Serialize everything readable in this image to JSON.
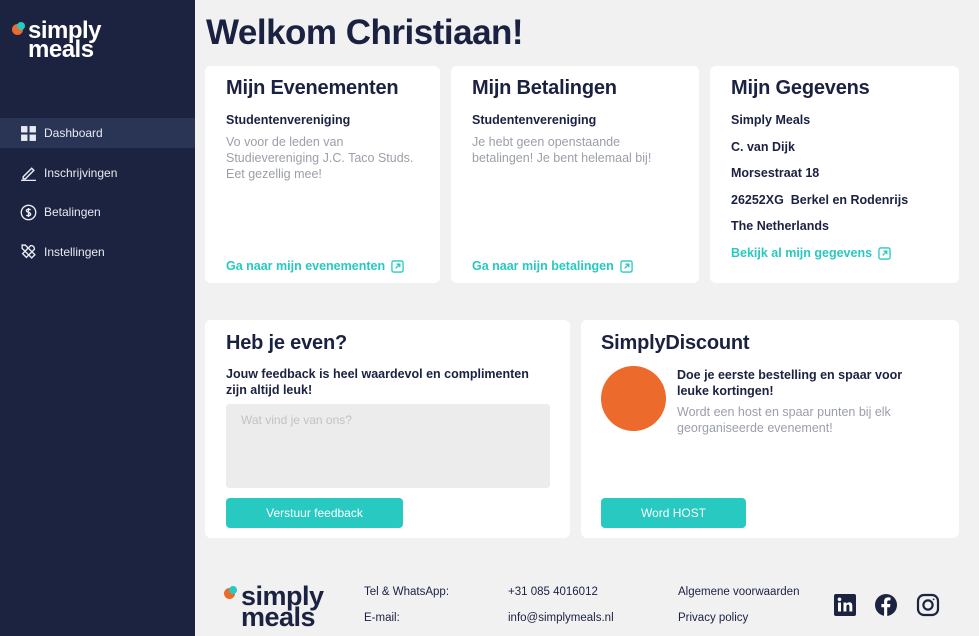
{
  "brand": {
    "logo_line1": "simply",
    "logo_line2": "meals",
    "orange": "#ec6a2b",
    "teal": "#27c9c0",
    "navy": "#1c2340"
  },
  "sidebar": {
    "items": [
      {
        "label": "Dashboard",
        "icon": "grid-icon",
        "active": true
      },
      {
        "label": "Inschrijvingen",
        "icon": "pencil-icon"
      },
      {
        "label": "Betalingen",
        "icon": "dollar-circle-icon"
      },
      {
        "label": "Instellingen",
        "icon": "tools-icon"
      }
    ]
  },
  "welcome": "Welkom Christiaan!",
  "events_card": {
    "title": "Mijn Evenementen",
    "subtitle": "Studentenvereniging",
    "text": "Vo voor de leden van Studievereniging J.C. Taco Studs. Eet gezellig mee!",
    "link": "Ga naar mijn evenementen"
  },
  "payments_card": {
    "title": "Mijn Betalingen",
    "subtitle": "Studentenvereniging",
    "text": "Je hebt geen openstaande betalingen! Je bent helemaal bij!",
    "link": "Ga naar mijn betalingen"
  },
  "details_card": {
    "title": "Mijn Gegevens",
    "lines": [
      "Simply Meals",
      "C. van Dijk",
      "Morsestraat 18",
      "26252XG  Berkel en Rodenrijs",
      "The Netherlands"
    ],
    "link": "Bekijk al mijn gegevens"
  },
  "feedback_card": {
    "title": "Heb je even?",
    "question": "Jouw feedback is heel waardevol en complimenten zijn altijd leuk!",
    "placeholder": "Wat vind je van ons?",
    "button": "Verstuur feedback"
  },
  "discount_card": {
    "title": "SimplyDiscount",
    "headline": "Doe je eerste bestelling en spaar voor leuke kortingen!",
    "text": "Wordt een host en spaar punten bij elk georganiseerde evenement!",
    "button": "Word HOST"
  },
  "footer": {
    "tel_label": "Tel & WhatsApp:",
    "tel_value": "+31 085 4016012",
    "email_label": "E-mail:",
    "email_value": "info@simplymeals.nl",
    "terms": "Algemene voorwaarden",
    "privacy": "Privacy policy",
    "social": [
      "linkedin-icon",
      "facebook-icon",
      "instagram-icon"
    ]
  }
}
